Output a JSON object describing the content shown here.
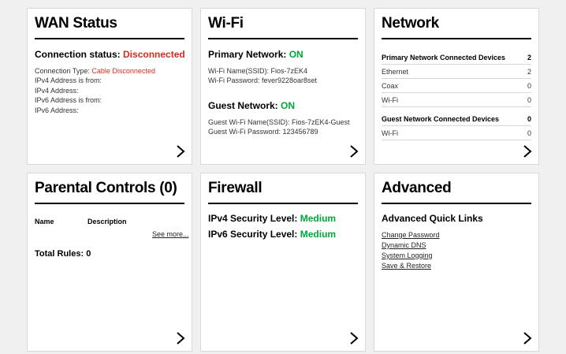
{
  "wan": {
    "title": "WAN Status",
    "status_label": "Connection status:",
    "status_value": "Disconnected",
    "type_label": "Connection Type:",
    "type_value": "Cable Disconnected",
    "lines": [
      "IPv4 Address is from:",
      "IPv4 Address:",
      "IPv6 Address is from:",
      "IPv6 Address:"
    ]
  },
  "wifi": {
    "title": "Wi-Fi",
    "primary_label": "Primary Network:",
    "primary_value": "ON",
    "primary_ssid": "Wi-Fi Name(SSID): Fios-7zEK4",
    "primary_password": "Wi-Fi Password: fever9228oar8set",
    "guest_label": "Guest Network:",
    "guest_value": "ON",
    "guest_ssid": "Guest Wi-Fi Name(SSID): Fios-7zEK4-Guest",
    "guest_password": "Guest Wi-Fi Password: 123456789"
  },
  "network": {
    "title": "Network",
    "primary_header": {
      "label": "Primary Network Connected Devices",
      "value": "2"
    },
    "primary_rows": [
      {
        "label": "Ethernet",
        "value": "2"
      },
      {
        "label": "Coax",
        "value": "0"
      },
      {
        "label": "Wi-Fi",
        "value": "0"
      }
    ],
    "guest_header": {
      "label": "Guest Network Connected Devices",
      "value": "0"
    },
    "guest_rows": [
      {
        "label": "Wi-Fi",
        "value": "0"
      }
    ]
  },
  "parental": {
    "title": "Parental Controls (0)",
    "col_name": "Name",
    "col_description": "Description",
    "see_more": "See more...",
    "total_rules": "Total Rules: 0"
  },
  "firewall": {
    "title": "Firewall",
    "ipv4_label": "IPv4 Security Level:",
    "ipv4_value": "Medium",
    "ipv6_label": "IPv6 Security Level:",
    "ipv6_value": "Medium"
  },
  "advanced": {
    "title": "Advanced",
    "subtitle": "Advanced Quick Links",
    "links": [
      "Change Password",
      "Dynamic DNS",
      "System Logging",
      "Save & Restore"
    ]
  },
  "colors": {
    "error": "#d52b1e",
    "ok": "#00a83a"
  },
  "icons": {
    "card_arrow": "chevron-right-icon"
  }
}
